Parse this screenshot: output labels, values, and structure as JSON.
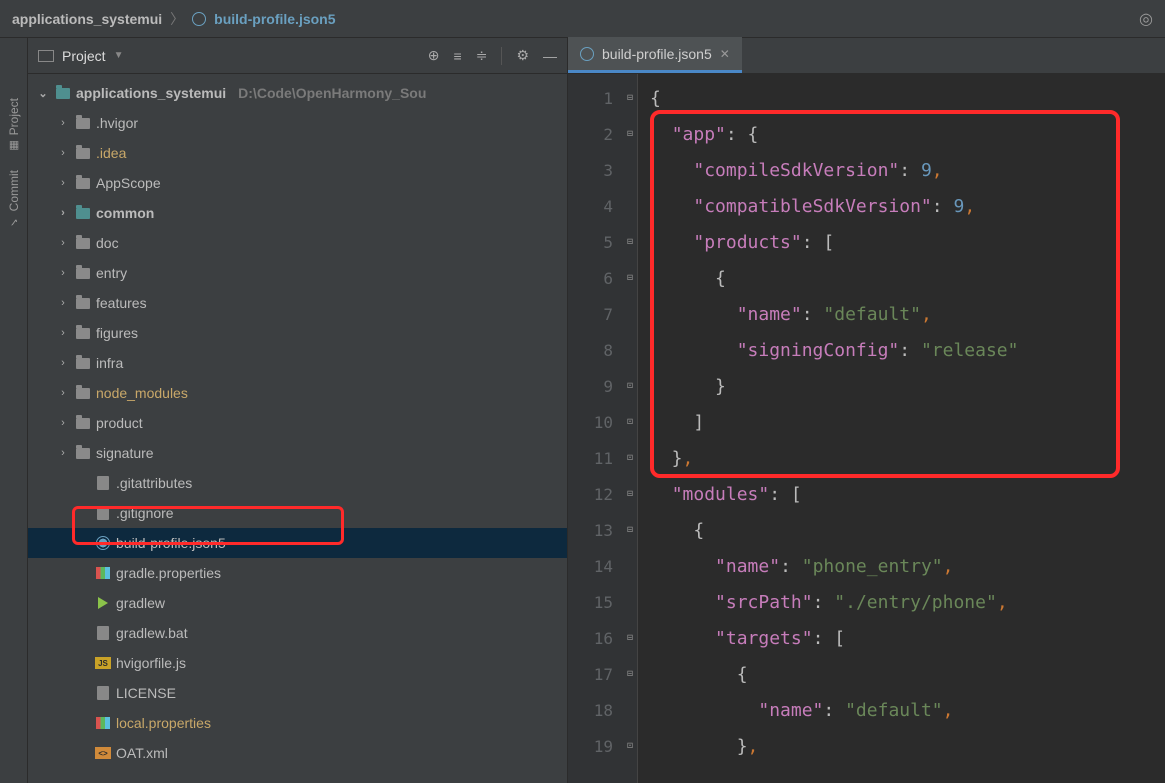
{
  "breadcrumb": {
    "root": "applications_systemui",
    "file": "build-profile.json5"
  },
  "leftTabs": {
    "project": "Project",
    "commit": "Commit"
  },
  "projectPanel": {
    "title": "Project",
    "rootName": "applications_systemui",
    "rootPath": "D:\\Code\\OpenHarmony_Sou"
  },
  "tree": {
    "hvigor": ".hvigor",
    "idea": ".idea",
    "appscope": "AppScope",
    "common": "common",
    "doc": "doc",
    "entry": "entry",
    "features": "features",
    "figures": "figures",
    "infra": "infra",
    "node_modules": "node_modules",
    "product": "product",
    "signature": "signature",
    "gitattributes": ".gitattributes",
    "gitignore": ".gitignore",
    "buildprofile": "build-profile.json5",
    "gradleprops": "gradle.properties",
    "gradlew": "gradlew",
    "gradlewbat": "gradlew.bat",
    "hvigorfile": "hvigorfile.js",
    "license": "LICENSE",
    "localprops": "local.properties",
    "oat": "OAT.xml"
  },
  "editorTab": {
    "filename": "build-profile.json5"
  },
  "lineNumbers": [
    "1",
    "2",
    "3",
    "4",
    "5",
    "6",
    "7",
    "8",
    "9",
    "10",
    "11",
    "12",
    "13",
    "14",
    "15",
    "16",
    "17",
    "18",
    "19"
  ],
  "code": {
    "k_app": "\"app\"",
    "k_compileSdk": "\"compileSdkVersion\"",
    "v_compileSdk": "9",
    "k_compatSdk": "\"compatibleSdkVersion\"",
    "v_compatSdk": "9",
    "k_products": "\"products\"",
    "k_name": "\"name\"",
    "v_default": "\"default\"",
    "k_signing": "\"signingConfig\"",
    "v_release": "\"release\"",
    "k_modules": "\"modules\"",
    "v_phone_entry": "\"phone_entry\"",
    "k_srcPath": "\"srcPath\"",
    "v_srcPath": "\"./entry/phone\"",
    "k_targets": "\"targets\""
  }
}
